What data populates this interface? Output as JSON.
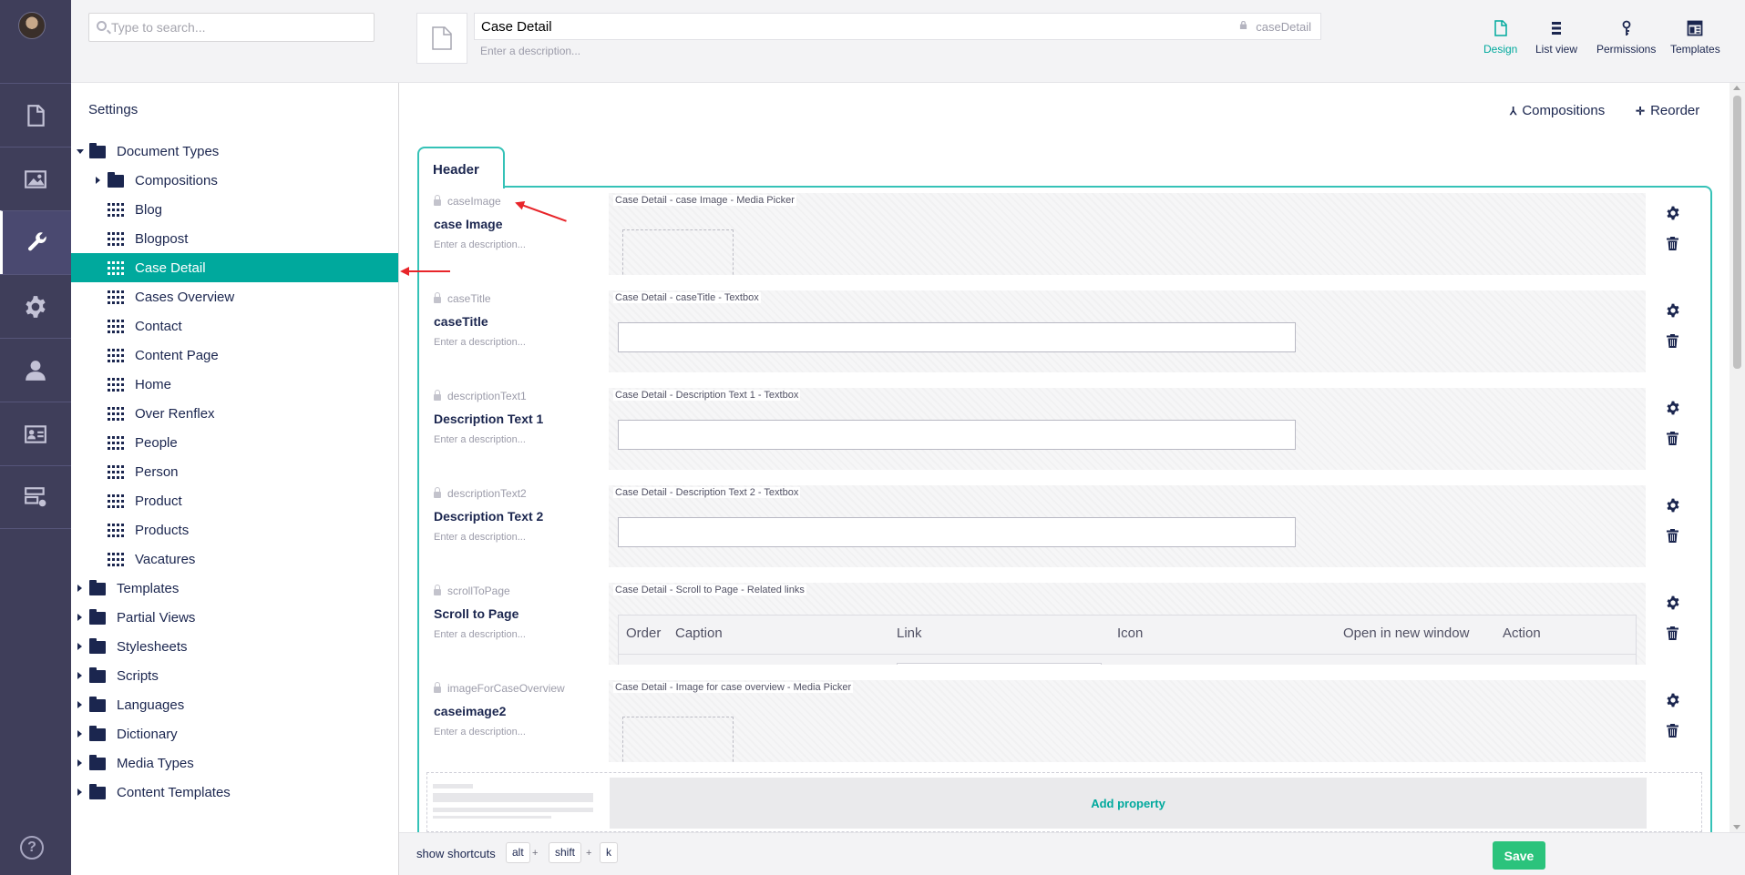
{
  "sidebar_sections": [
    "content-icon",
    "media-icon",
    "settings-wrench-icon",
    "packages-gear-icon",
    "users-icon",
    "members-card-icon",
    "forms-icon"
  ],
  "search": {
    "placeholder": "Type to search..."
  },
  "tree": {
    "heading": "Settings",
    "root": "Document Types",
    "items": [
      "Compositions",
      "Blog",
      "Blogpost",
      "Case Detail",
      "Cases Overview",
      "Contact",
      "Content Page",
      "Home",
      "Over Renflex",
      "People",
      "Person",
      "Product",
      "Products",
      "Vacatures"
    ],
    "siblings": [
      "Templates",
      "Partial Views",
      "Stylesheets",
      "Scripts",
      "Languages",
      "Dictionary",
      "Media Types",
      "Content Templates"
    ],
    "active": "Case Detail"
  },
  "header": {
    "name": "Case Detail",
    "alias": "caseDetail",
    "description_placeholder": "Enter a description...",
    "views": [
      "Design",
      "List view",
      "Permissions",
      "Templates"
    ],
    "active_view": "Design"
  },
  "toolbar": {
    "compositions": "Compositions",
    "reorder": "Reorder"
  },
  "tab_name": "Header",
  "properties": [
    {
      "alias": "caseImage",
      "name": "case Image",
      "description": "Enter a description...",
      "editor_label": "Case Detail - case Image - Media Picker",
      "type": "media"
    },
    {
      "alias": "caseTitle",
      "name": "caseTitle",
      "description": "Enter a description...",
      "editor_label": "Case Detail - caseTitle - Textbox",
      "type": "textbox"
    },
    {
      "alias": "descriptionText1",
      "name": "Description Text 1",
      "description": "Enter a description...",
      "editor_label": "Case Detail - Description Text 1 - Textbox",
      "type": "textbox"
    },
    {
      "alias": "descriptionText2",
      "name": "Description Text 2",
      "description": "Enter a description...",
      "editor_label": "Case Detail - Description Text 2 - Textbox",
      "type": "textbox"
    },
    {
      "alias": "scrollToPage",
      "name": "Scroll to Page",
      "description": "Enter a description...",
      "editor_label": "Case Detail - Scroll to Page - Related links",
      "type": "links"
    },
    {
      "alias": "imageForCaseOverview",
      "name": "caseimage2",
      "description": "Enter a description...",
      "editor_label": "Case Detail - Image for case overview - Media Picker",
      "type": "media"
    }
  ],
  "links_columns": [
    "Order",
    "Caption",
    "Link",
    "Icon",
    "Open in new window",
    "Action"
  ],
  "add_property": "Add property",
  "footer": {
    "shortcuts_label": "show shortcuts",
    "keys": [
      "alt",
      "shift",
      "k"
    ],
    "plus": "+",
    "save": "Save"
  },
  "colors": {
    "accent": "#00a99d",
    "appbar": "#3f3e5a",
    "save": "#2bc37c",
    "annotation": "#e8252a"
  }
}
